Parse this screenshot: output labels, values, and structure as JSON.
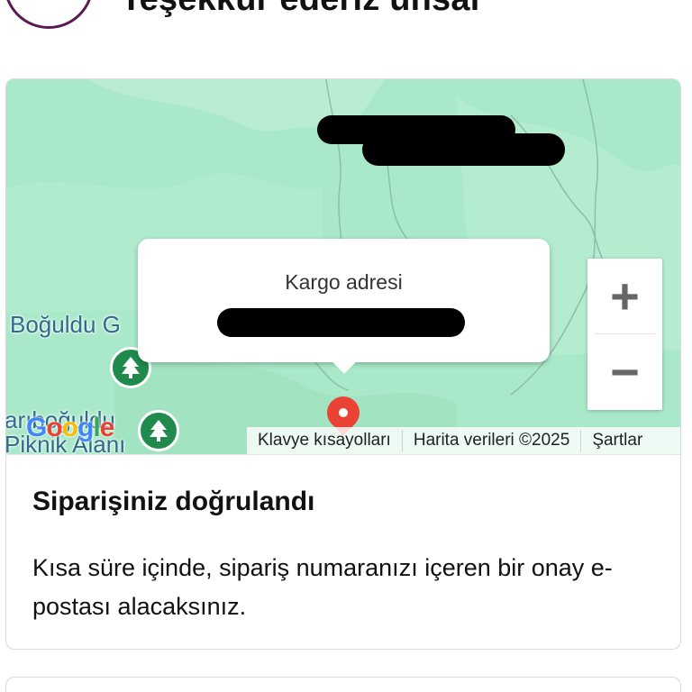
{
  "header": {
    "thanks_text": "Teşekkür ederiz ünsal"
  },
  "map": {
    "popup_title": "Kargo adresi",
    "place_label_1": "Boğuldu G",
    "place_label_2a": "arıboğuldu",
    "place_label_2b": "Piknik Alanı",
    "zoom_in": "+",
    "zoom_out": "−",
    "google_logo": {
      "letters": [
        "G",
        "o",
        "o",
        "g",
        "l",
        "e"
      ],
      "colors": [
        "#4285F4",
        "#EA4335",
        "#FBBC05",
        "#4285F4",
        "#34A853",
        "#EA4335"
      ]
    },
    "attribution": {
      "shortcuts": "Klavye kısayolları",
      "data": "Harita verileri ©2025",
      "terms": "Şartlar"
    },
    "icons": {
      "park": "tree-icon",
      "destination": "map-pin-icon"
    }
  },
  "confirmation": {
    "title": "Siparişiniz doğrulandı",
    "text": "Kısa süre içinde, sipariş numaranızı içeren bir onay e-postası alacaksınız."
  },
  "colors": {
    "map_bg": "#a9e8c8",
    "accent_circle": "#5a1a52",
    "park_pin": "#1f8a4c",
    "destination_pin": "#ea4335"
  }
}
